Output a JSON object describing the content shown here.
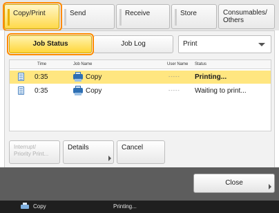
{
  "tabs": [
    {
      "label": "Copy/Print",
      "active": true
    },
    {
      "label": "Send",
      "active": false
    },
    {
      "label": "Receive",
      "active": false
    },
    {
      "label": "Store",
      "active": false
    },
    {
      "label": "Consumables/\nOthers",
      "active": false
    }
  ],
  "panel": {
    "seg_job_status": "Job Status",
    "seg_job_log": "Job Log",
    "filter_value": "Print"
  },
  "table": {
    "headers": {
      "time": "Time",
      "job_name": "Job Name",
      "user_name": "User Name",
      "status": "Status"
    },
    "rows": [
      {
        "time": "0:35",
        "job_name": "Copy",
        "user_name": "-----",
        "status": "Printing..."
      },
      {
        "time": "0:35",
        "job_name": "Copy",
        "user_name": "-----",
        "status": "Waiting to print..."
      }
    ]
  },
  "actions": {
    "interrupt": "Interrupt/\nPriority Print...",
    "details": "Details",
    "cancel": "Cancel"
  },
  "bottom": {
    "close": "Close"
  },
  "statusbar": {
    "job": "Copy",
    "state": "Printing..."
  },
  "colors": {
    "accent_yellow": "#ffd94a",
    "highlight_ring": "#ff8a00",
    "selected_row": "#ffe680"
  },
  "icons": {
    "tab_marker": "tab-indicator-icon",
    "job_document": "document-icon",
    "copy_job": "copier-icon"
  }
}
